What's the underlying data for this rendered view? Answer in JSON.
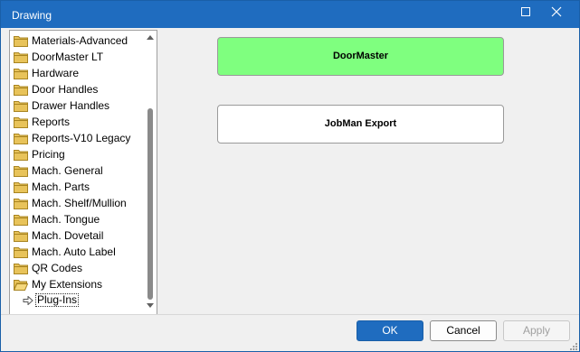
{
  "window": {
    "title": "Drawing"
  },
  "tree": {
    "items": [
      {
        "label": "Materials-Advanced"
      },
      {
        "label": "DoorMaster LT"
      },
      {
        "label": "Hardware"
      },
      {
        "label": "Door Handles"
      },
      {
        "label": "Drawer Handles"
      },
      {
        "label": "Reports"
      },
      {
        "label": "Reports-V10 Legacy"
      },
      {
        "label": "Pricing"
      },
      {
        "label": "Mach. General"
      },
      {
        "label": "Mach. Parts"
      },
      {
        "label": "Mach. Shelf/Mullion"
      },
      {
        "label": "Mach. Tongue"
      },
      {
        "label": "Mach. Dovetail"
      },
      {
        "label": "Mach. Auto Label"
      },
      {
        "label": "QR Codes"
      },
      {
        "label": "My Extensions"
      }
    ],
    "selected_child": {
      "label": "Plug-Ins"
    }
  },
  "plugins": {
    "doormaster": "DoorMaster",
    "jobman": "JobMan Export"
  },
  "buttons": {
    "ok": "OK",
    "cancel": "Cancel",
    "apply": "Apply"
  },
  "colors": {
    "titlebar": "#1f6cbf",
    "doormaster_bg": "#7fff7f",
    "folder": "#e8c35a"
  }
}
